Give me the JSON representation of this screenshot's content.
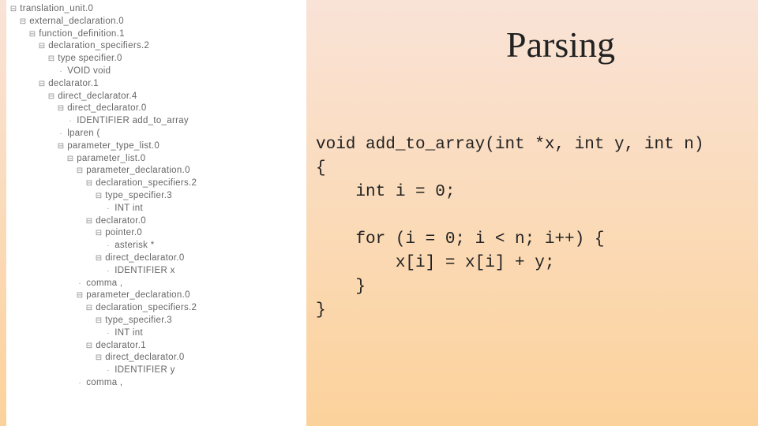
{
  "title": "Parsing",
  "tree": [
    {
      "indent": 0,
      "marker": "⊟",
      "label": "translation_unit.0"
    },
    {
      "indent": 1,
      "marker": "⊟",
      "label": "external_declaration.0"
    },
    {
      "indent": 2,
      "marker": "⊟",
      "label": "function_definition.1"
    },
    {
      "indent": 3,
      "marker": "⊟",
      "label": "declaration_specifiers.2"
    },
    {
      "indent": 4,
      "marker": "⊟",
      "label": "type specifier.0"
    },
    {
      "indent": 5,
      "marker": "·",
      "label": "VOID void"
    },
    {
      "indent": 3,
      "marker": "⊟",
      "label": "declarator.1"
    },
    {
      "indent": 4,
      "marker": "⊟",
      "label": "direct_declarator.4"
    },
    {
      "indent": 5,
      "marker": "⊟",
      "label": "direct_declarator.0"
    },
    {
      "indent": 6,
      "marker": "·",
      "label": "IDENTIFIER add_to_array"
    },
    {
      "indent": 5,
      "marker": "·",
      "label": "lparen ("
    },
    {
      "indent": 5,
      "marker": "⊟",
      "label": "parameter_type_list.0"
    },
    {
      "indent": 6,
      "marker": "⊟",
      "label": "parameter_list.0"
    },
    {
      "indent": 7,
      "marker": "⊟",
      "label": "parameter_declaration.0"
    },
    {
      "indent": 8,
      "marker": "⊟",
      "label": "declaration_specifiers.2"
    },
    {
      "indent": 9,
      "marker": "⊟",
      "label": "type_specifier.3"
    },
    {
      "indent": 10,
      "marker": "·",
      "label": "INT int"
    },
    {
      "indent": 8,
      "marker": "⊟",
      "label": "declarator.0"
    },
    {
      "indent": 9,
      "marker": "⊟",
      "label": "pointer.0"
    },
    {
      "indent": 10,
      "marker": "·",
      "label": "asterisk *"
    },
    {
      "indent": 9,
      "marker": "⊟",
      "label": "direct_declarator.0"
    },
    {
      "indent": 10,
      "marker": "·",
      "label": "IDENTIFIER x"
    },
    {
      "indent": 7,
      "marker": "·",
      "label": "comma ,"
    },
    {
      "indent": 7,
      "marker": "⊟",
      "label": "parameter_declaration.0"
    },
    {
      "indent": 8,
      "marker": "⊟",
      "label": "declaration_specifiers.2"
    },
    {
      "indent": 9,
      "marker": "⊟",
      "label": "type_specifier.3"
    },
    {
      "indent": 10,
      "marker": "·",
      "label": "INT int"
    },
    {
      "indent": 8,
      "marker": "⊟",
      "label": "declarator.1"
    },
    {
      "indent": 9,
      "marker": "⊟",
      "label": "direct_declarator.0"
    },
    {
      "indent": 10,
      "marker": "·",
      "label": "IDENTIFIER y"
    },
    {
      "indent": 7,
      "marker": "·",
      "label": "comma ,"
    }
  ],
  "code": "void add_to_array(int *x, int y, int n)\n{\n    int i = 0;\n\n    for (i = 0; i < n; i++) {\n        x[i] = x[i] + y;\n    }\n}"
}
